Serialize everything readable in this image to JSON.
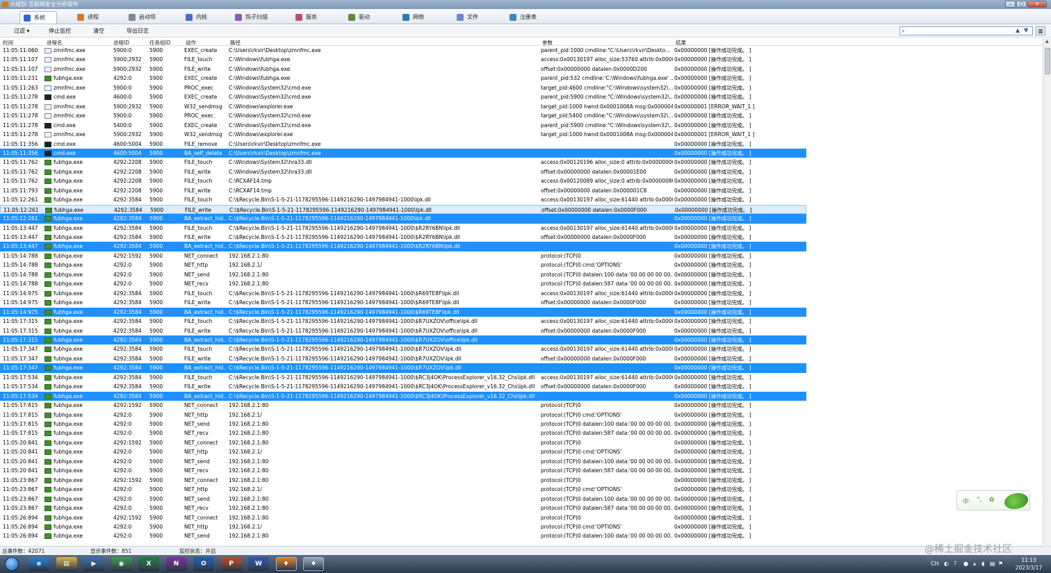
{
  "window": {
    "title": "火绒剑-互联网安全分析软件",
    "min": "–",
    "max": "□",
    "close": "✕"
  },
  "tabs": [
    {
      "label": "系统",
      "icon": "system-icon",
      "color": "#2a6bc9",
      "active": true
    },
    {
      "label": "进程",
      "icon": "process-icon",
      "color": "#d9781e"
    },
    {
      "label": "启动项",
      "icon": "startup-icon",
      "color": "#7a8aa0"
    },
    {
      "label": "内核",
      "icon": "kernel-icon",
      "color": "#4a6fbf"
    },
    {
      "label": "钩子扫描",
      "icon": "hook-scan-icon",
      "color": "#8a5ab8"
    },
    {
      "label": "服务",
      "icon": "service-icon",
      "color": "#c44a6a"
    },
    {
      "label": "驱动",
      "icon": "driver-icon",
      "color": "#5a8a3a"
    },
    {
      "label": "网络",
      "icon": "network-icon",
      "color": "#2a7ab0"
    },
    {
      "label": "文件",
      "icon": "file-icon",
      "color": "#6a8ac8"
    },
    {
      "label": "注册表",
      "icon": "registry-icon",
      "color": "#3a8ab8"
    }
  ],
  "toolbar": {
    "filter": "过滤 ▾",
    "stop": "停止监控",
    "clear": "清空",
    "export": "导出日志"
  },
  "search": {
    "placeholder": "",
    "up": "▲",
    "down": "▼",
    "icon": "⌕"
  },
  "columns": {
    "time": "时间",
    "pname": "进程名",
    "pid": "进程ID",
    "tid": "任务组ID",
    "action": "动作",
    "path": "路径",
    "params": "参数",
    "result": "结果"
  },
  "events": [
    {
      "t": "11:05:11:060",
      "n": "zmnfmc.exe",
      "ic": "app",
      "p": "5900:0",
      "g": "5900",
      "a": "EXEC_create",
      "path": "C:\\Users\\rkvir\\Desktop\\zmnfmc.exe",
      "par": "parent_pid:1000 cmdline:\"C:\\Users\\rkvir\\Deskto...",
      "r": "0x00000000 [操作成功完成。 ]"
    },
    {
      "t": "11:05:11:107",
      "n": "zmnfmc.exe",
      "ic": "app",
      "p": "5900:2932",
      "g": "5900",
      "a": "FILE_touch",
      "path": "C:\\Windows\\fubhga.exe",
      "par": "access:0x00130197 alloc_size:53760 attrib:0x0000...",
      "r": "0x00000000 [操作成功完成。 ]"
    },
    {
      "t": "11:05:11:107",
      "n": "zmnfmc.exe",
      "ic": "app",
      "p": "5900:2932",
      "g": "5900",
      "a": "FILE_write",
      "path": "C:\\Windows\\fubhga.exe",
      "par": "offset:0x00000000 datalen:0x0000D200",
      "r": "0x00000000 [操作成功完成。 ]"
    },
    {
      "t": "11:05:11:231",
      "n": "fubhga.exe",
      "ic": "fub",
      "p": "4292:0",
      "g": "5900",
      "a": "EXEC_create",
      "path": "C:\\Windows\\fubhga.exe",
      "par": "parent_pid:532 cmdline:'C:\\Windows\\fubhga.exe' ...",
      "r": "0x00000000 [操作成功完成。 ]"
    },
    {
      "t": "11:05:11:263",
      "n": "zmnfmc.exe",
      "ic": "app",
      "p": "5900:0",
      "g": "5900",
      "a": "PROC_exec",
      "path": "C:\\Windows\\System32\\cmd.exe",
      "par": "target_pid:4600 cmdline:\"C:\\Windows\\system32\\...",
      "r": "0x00000000 [操作成功完成。 ]"
    },
    {
      "t": "11:05:11:278",
      "n": "cmd.exe",
      "ic": "cmd",
      "p": "4600:0",
      "g": "5900",
      "a": "EXEC_create",
      "path": "C:\\Windows\\System32\\cmd.exe",
      "par": "parent_pid:5900 cmdline:\"C:\\Windows\\system32\\...",
      "r": "0x00000000 [操作成功完成。 ]"
    },
    {
      "t": "11:05:11:278",
      "n": "zmnfmc.exe",
      "ic": "app",
      "p": "5900:2932",
      "g": "5900",
      "a": "W32_sendmsg",
      "path": "C:\\Windows\\explorer.exe",
      "par": "target_pid:1000 hwnd:0x0001008A msg:0x000004...",
      "r": "0x00000001 [ERROR_WAIT_1 ]"
    },
    {
      "t": "11:05:11:278",
      "n": "zmnfmc.exe",
      "ic": "app",
      "p": "5900:0",
      "g": "5900",
      "a": "PROC_exec",
      "path": "C:\\Windows\\System32\\cmd.exe",
      "par": "target_pid:5400 cmdline:\"C:\\Windows\\system32\\...",
      "r": "0x00000000 [操作成功完成。 ]"
    },
    {
      "t": "11:05:11:278",
      "n": "cmd.exe",
      "ic": "cmd",
      "p": "5400:0",
      "g": "5900",
      "a": "EXEC_create",
      "path": "C:\\Windows\\System32\\cmd.exe",
      "par": "parent_pid:5900 cmdline:\"C:\\Windows\\system32\\...",
      "r": "0x00000000 [操作成功完成。 ]"
    },
    {
      "t": "11:05:11:278",
      "n": "zmnfmc.exe",
      "ic": "app",
      "p": "5900:2932",
      "g": "5900",
      "a": "W32_sendmsg",
      "path": "C:\\Windows\\explorer.exe",
      "par": "target_pid:1000 hwnd:0x0001008A msg:0x000004...",
      "r": "0x00000001 [ERROR_WAIT_1 ]"
    },
    {
      "t": "11:05:11:356",
      "n": "cmd.exe",
      "ic": "cmd",
      "p": "4600:5004",
      "g": "5900",
      "a": "FILE_remove",
      "path": "C:\\Users\\rkvir\\Desktop\\zmnfmc.exe",
      "par": "",
      "r": "0x00000000 [操作成功完成。 ]"
    },
    {
      "t": "11:05:11:356",
      "n": "cmd.exe",
      "ic": "cmd",
      "p": "4600:5004",
      "g": "5900",
      "a": "BA_self_delete",
      "path": "C:\\Users\\rkvir\\Desktop\\zmnfmc.exe",
      "par": "",
      "r": "0x00000000 [操作成功完成。 ]",
      "sel": true
    },
    {
      "t": "11:05:11:762",
      "n": "fubhga.exe",
      "ic": "fub",
      "p": "4292:2208",
      "g": "5900",
      "a": "FILE_touch",
      "path": "C:\\Windows\\System32\\hra33.dll",
      "par": "access:0x00120196 alloc_size:0 attrib:0x00000000...",
      "r": "0x00000000 [操作成功完成。 ]"
    },
    {
      "t": "11:05:11:762",
      "n": "fubhga.exe",
      "ic": "fub",
      "p": "4292:2208",
      "g": "5900",
      "a": "FILE_write",
      "path": "C:\\Windows\\System32\\hra33.dll",
      "par": "offset:0x00000000 datalen:0x00001E00",
      "r": "0x00000000 [操作成功完成。 ]"
    },
    {
      "t": "11:05:11:762",
      "n": "fubhga.exe",
      "ic": "fub",
      "p": "4292:2208",
      "g": "5900",
      "a": "FILE_touch",
      "path": "C:\\RCXAF14.tmp",
      "par": "access:0x00120089 alloc_size:0 attrib:0x00000080...",
      "r": "0x00000000 [操作成功完成。 ]"
    },
    {
      "t": "11:05:11:793",
      "n": "fubhga.exe",
      "ic": "fub",
      "p": "4292:2208",
      "g": "5900",
      "a": "FILE_write",
      "path": "C:\\RCXAF14.tmp",
      "par": "offset:0x00000000 datalen:0x000001C8",
      "r": "0x00000000 [操作成功完成。 ]"
    },
    {
      "t": "11:05:12:261",
      "n": "fubhga.exe",
      "ic": "fub",
      "p": "4292:3584",
      "g": "5900",
      "a": "FILE_touch",
      "path": "C:\\$Recycle.Bin\\S-1-5-21-1178295596-1149216290-1497984941-1000\\lpk.dll",
      "par": "access:0x00130197 alloc_size:61440 attrib:0x0000...",
      "r": "0x00000000 [操作成功完成。 ]"
    },
    {
      "t": "11:05:12:261",
      "n": "fubhga.exe",
      "ic": "fub",
      "p": "4292:3584",
      "g": "5900",
      "a": "FILE_write",
      "path": "C:\\$Recycle.Bin\\S-1-5-21-1178295596-1149216290-1497984941-1000\\lpk.dll",
      "par": "offset:0x00000000 datalen:0x0000F000",
      "r": "0x00000000 [操作成功完成。 ]",
      "hov": true
    },
    {
      "t": "11:05:12:261",
      "n": "fubhga.exe",
      "ic": "fub",
      "p": "4292:3584",
      "g": "5900",
      "a": "BA_extract_hid...",
      "path": "C:\\$Recycle.Bin\\S-1-5-21-1178295596-1149216290-1497984941-1000\\lpk.dll",
      "par": "",
      "r": "0x00000000 [操作成功完成。 ]",
      "sel": true
    },
    {
      "t": "11:05:13:447",
      "n": "fubhga.exe",
      "ic": "fub",
      "p": "4292:3584",
      "g": "5900",
      "a": "FILE_touch",
      "path": "C:\\$Recycle.Bin\\S-1-5-21-1178295596-1149216290-1497984941-1000\\$R2RY6BN\\lpk.dll",
      "par": "access:0x00130197 alloc_size:61440 attrib:0x0000...",
      "r": "0x00000000 [操作成功完成。 ]"
    },
    {
      "t": "11:05:13:447",
      "n": "fubhga.exe",
      "ic": "fub",
      "p": "4292:3584",
      "g": "5900",
      "a": "FILE_write",
      "path": "C:\\$Recycle.Bin\\S-1-5-21-1178295596-1149216290-1497984941-1000\\$R2RY6BN\\lpk.dll",
      "par": "offset:0x00000000 datalen:0x0000F000",
      "r": "0x00000000 [操作成功完成。 ]"
    },
    {
      "t": "11:05:13:447",
      "n": "fubhga.exe",
      "ic": "fub",
      "p": "4292:3584",
      "g": "5900",
      "a": "BA_extract_hid...",
      "path": "C:\\$Recycle.Bin\\S-1-5-21-1178295596-1149216290-1497984941-1000\\$R2RY6BN\\lpk.dll",
      "par": "",
      "r": "0x00000000 [操作成功完成。 ]",
      "sel": true
    },
    {
      "t": "11:05:14:788",
      "n": "fubhga.exe",
      "ic": "fub",
      "p": "4292:1592",
      "g": "5900",
      "a": "NET_connect",
      "path": "192.168.2.1:80",
      "par": "protocol:(TCP)0",
      "r": "0x00000000 [操作成功完成。 ]"
    },
    {
      "t": "11:05:14:788",
      "n": "fubhga.exe",
      "ic": "fub",
      "p": "4292:0",
      "g": "5900",
      "a": "NET_http",
      "path": "192.168.2.1/",
      "par": "protocol:(TCP)0 cmd:'OPTIONS'",
      "r": "0x00000000 [操作成功完成。 ]"
    },
    {
      "t": "11:05:14:788",
      "n": "fubhga.exe",
      "ic": "fub",
      "p": "4292:0",
      "g": "5900",
      "a": "NET_send",
      "path": "192.168.2.1:80",
      "par": "protocol:(TCP)0 datalen:100 data:'00 00 00 00 00...",
      "r": "0x00000000 [操作成功完成。 ]"
    },
    {
      "t": "11:05:14:788",
      "n": "fubhga.exe",
      "ic": "fub",
      "p": "4292:0",
      "g": "5900",
      "a": "NET_recv",
      "path": "192.168.2.1:80",
      "par": "protocol:(TCP)0 datalen:587 data:'00 00 00 00 00...",
      "r": "0x00000000 [操作成功完成。 ]"
    },
    {
      "t": "11:05:14:975",
      "n": "fubhga.exe",
      "ic": "fub",
      "p": "4292:3584",
      "g": "5900",
      "a": "FILE_touch",
      "path": "C:\\$Recycle.Bin\\S-1-5-21-1178295596-1149216290-1497984941-1000\\$R69TE8F\\lpk.dll",
      "par": "access:0x00130197 alloc_size:61440 attrib:0x0000...",
      "r": "0x00000000 [操作成功完成。 ]"
    },
    {
      "t": "11:05:14:975",
      "n": "fubhga.exe",
      "ic": "fub",
      "p": "4292:3584",
      "g": "5900",
      "a": "FILE_write",
      "path": "C:\\$Recycle.Bin\\S-1-5-21-1178295596-1149216290-1497984941-1000\\$R69TE8F\\lpk.dll",
      "par": "offset:0x00000000 datalen:0x0000F000",
      "r": "0x00000000 [操作成功完成。 ]"
    },
    {
      "t": "11:05:14:975",
      "n": "fubhga.exe",
      "ic": "fub",
      "p": "4292:3584",
      "g": "5900",
      "a": "BA_extract_hid...",
      "path": "C:\\$Recycle.Bin\\S-1-5-21-1178295596-1149216290-1497984941-1000\\$R69TE8F\\lpk.dll",
      "par": "",
      "r": "0x00000000 [操作成功完成。 ]",
      "sel": true
    },
    {
      "t": "11:05:17:315",
      "n": "fubhga.exe",
      "ic": "fub",
      "p": "4292:3584",
      "g": "5900",
      "a": "FILE_touch",
      "path": "C:\\$Recycle.Bin\\S-1-5-21-1178295596-1149216290-1497984941-1000\\$R7UXZOV\\office\\lpk.dll",
      "par": "access:0x00130197 alloc_size:61440 attrib:0x0000...",
      "r": "0x00000000 [操作成功完成。 ]"
    },
    {
      "t": "11:05:17:315",
      "n": "fubhga.exe",
      "ic": "fub",
      "p": "4292:3584",
      "g": "5900",
      "a": "FILE_write",
      "path": "C:\\$Recycle.Bin\\S-1-5-21-1178295596-1149216290-1497984941-1000\\$R7UXZOV\\office\\lpk.dll",
      "par": "offset:0x00000000 datalen:0x0000F000",
      "r": "0x00000000 [操作成功完成。 ]"
    },
    {
      "t": "11:05:17:315",
      "n": "fubhga.exe",
      "ic": "fub",
      "p": "4292:3584",
      "g": "5900",
      "a": "BA_extract_hid...",
      "path": "C:\\$Recycle.Bin\\S-1-5-21-1178295596-1149216290-1497984941-1000\\$R7UXZOV\\office\\lpk.dll",
      "par": "",
      "r": "0x00000000 [操作成功完成。 ]",
      "sel": true
    },
    {
      "t": "11:05:17:347",
      "n": "fubhga.exe",
      "ic": "fub",
      "p": "4292:3584",
      "g": "5900",
      "a": "FILE_touch",
      "path": "C:\\$Recycle.Bin\\S-1-5-21-1178295596-1149216290-1497984941-1000\\$R7UXZOV\\lpk.dll",
      "par": "access:0x00130197 alloc_size:61440 attrib:0x0000...",
      "r": "0x00000000 [操作成功完成。 ]"
    },
    {
      "t": "11:05:17:347",
      "n": "fubhga.exe",
      "ic": "fub",
      "p": "4292:3584",
      "g": "5900",
      "a": "FILE_write",
      "path": "C:\\$Recycle.Bin\\S-1-5-21-1178295596-1149216290-1497984941-1000\\$R7UXZOV\\lpk.dll",
      "par": "offset:0x00000000 datalen:0x0000F000",
      "r": "0x00000000 [操作成功完成。 ]"
    },
    {
      "t": "11:05:17:347",
      "n": "fubhga.exe",
      "ic": "fub",
      "p": "4292:3584",
      "g": "5900",
      "a": "BA_extract_hid...",
      "path": "C:\\$Recycle.Bin\\S-1-5-21-1178295596-1149216290-1497984941-1000\\$R7UXZOV\\lpk.dll",
      "par": "",
      "r": "0x00000000 [操作成功完成。 ]",
      "sel": true
    },
    {
      "t": "11:05:17:534",
      "n": "fubhga.exe",
      "ic": "fub",
      "p": "4292:3584",
      "g": "5900",
      "a": "FILE_touch",
      "path": "C:\\$Recycle.Bin\\S-1-5-21-1178295596-1149216290-1497984941-1000\\$RC3J4OK\\ProcessExplorer_v16.32_Chs\\lpk.dll",
      "par": "access:0x00130197 alloc_size:61440 attrib:0x0000...",
      "r": "0x00000000 [操作成功完成。 ]"
    },
    {
      "t": "11:05:17:534",
      "n": "fubhga.exe",
      "ic": "fub",
      "p": "4292:3584",
      "g": "5900",
      "a": "FILE_write",
      "path": "C:\\$Recycle.Bin\\S-1-5-21-1178295596-1149216290-1497984941-1000\\$RC3J4OK\\ProcessExplorer_v16.32_Chs\\lpk.dll",
      "par": "offset:0x00000000 datalen:0x0000F000",
      "r": "0x00000000 [操作成功完成。 ]"
    },
    {
      "t": "11:05:17:534",
      "n": "fubhga.exe",
      "ic": "fub",
      "p": "4292:3584",
      "g": "5900",
      "a": "BA_extract_hid...",
      "path": "C:\\$Recycle.Bin\\S-1-5-21-1178295596-1149216290-1497984941-1000\\$RC3J4OK\\ProcessExplorer_v16.32_Chs\\lpk.dll",
      "par": "",
      "r": "0x00000000 [操作成功完成。 ]",
      "sel": true
    },
    {
      "t": "11:05:17:815",
      "n": "fubhga.exe",
      "ic": "fub",
      "p": "4292:1592",
      "g": "5900",
      "a": "NET_connect",
      "path": "192.168.2.1:80",
      "par": "protocol:(TCP)0",
      "r": "0x00000000 [操作成功完成。 ]"
    },
    {
      "t": "11:05:17:815",
      "n": "fubhga.exe",
      "ic": "fub",
      "p": "4292:0",
      "g": "5900",
      "a": "NET_http",
      "path": "192.168.2.1/",
      "par": "protocol:(TCP)0 cmd:'OPTIONS'",
      "r": "0x00000000 [操作成功完成。 ]"
    },
    {
      "t": "11:05:17:815",
      "n": "fubhga.exe",
      "ic": "fub",
      "p": "4292:0",
      "g": "5900",
      "a": "NET_send",
      "path": "192.168.2.1:80",
      "par": "protocol:(TCP)0 datalen:100 data:'00 00 00 00 00...",
      "r": "0x00000000 [操作成功完成。 ]"
    },
    {
      "t": "11:05:17:815",
      "n": "fubhga.exe",
      "ic": "fub",
      "p": "4292:0",
      "g": "5900",
      "a": "NET_recv",
      "path": "192.168.2.1:80",
      "par": "protocol:(TCP)0 datalen:587 data:'00 00 00 00 00...",
      "r": "0x00000000 [操作成功完成。 ]"
    },
    {
      "t": "11:05:20:841",
      "n": "fubhga.exe",
      "ic": "fub",
      "p": "4292:1592",
      "g": "5900",
      "a": "NET_connect",
      "path": "192.168.2.1:80",
      "par": "protocol:(TCP)0",
      "r": "0x00000000 [操作成功完成。 ]"
    },
    {
      "t": "11:05:20:841",
      "n": "fubhga.exe",
      "ic": "fub",
      "p": "4292:0",
      "g": "5900",
      "a": "NET_http",
      "path": "192.168.2.1/",
      "par": "protocol:(TCP)0 cmd:'OPTIONS'",
      "r": "0x00000000 [操作成功完成。 ]"
    },
    {
      "t": "11:05:20:841",
      "n": "fubhga.exe",
      "ic": "fub",
      "p": "4292:0",
      "g": "5900",
      "a": "NET_send",
      "path": "192.168.2.1:80",
      "par": "protocol:(TCP)0 datalen:100 data:'00 00 00 00 00...",
      "r": "0x00000000 [操作成功完成。 ]"
    },
    {
      "t": "11:05:20:841",
      "n": "fubhga.exe",
      "ic": "fub",
      "p": "4292:0",
      "g": "5900",
      "a": "NET_recv",
      "path": "192.168.2.1:80",
      "par": "protocol:(TCP)0 datalen:587 data:'00 00 00 00 00...",
      "r": "0x00000000 [操作成功完成。 ]"
    },
    {
      "t": "11:05:23:867",
      "n": "fubhga.exe",
      "ic": "fub",
      "p": "4292:1592",
      "g": "5900",
      "a": "NET_connect",
      "path": "192.168.2.1:80",
      "par": "protocol:(TCP)0",
      "r": "0x00000000 [操作成功完成。 ]"
    },
    {
      "t": "11:05:23:867",
      "n": "fubhga.exe",
      "ic": "fub",
      "p": "4292:0",
      "g": "5900",
      "a": "NET_http",
      "path": "192.168.2.1/",
      "par": "protocol:(TCP)0 cmd:'OPTIONS'",
      "r": "0x00000000 [操作成功完成。 ]"
    },
    {
      "t": "11:05:23:867",
      "n": "fubhga.exe",
      "ic": "fub",
      "p": "4292:0",
      "g": "5900",
      "a": "NET_send",
      "path": "192.168.2.1:80",
      "par": "protocol:(TCP)0 datalen:100 data:'00 00 00 00 00...",
      "r": "0x00000000 [操作成功完成。 ]"
    },
    {
      "t": "11:05:23:867",
      "n": "fubhga.exe",
      "ic": "fub",
      "p": "4292:0",
      "g": "5900",
      "a": "NET_recv",
      "path": "192.168.2.1:80",
      "par": "protocol:(TCP)0 datalen:587 data:'00 00 00 00 00...",
      "r": "0x00000000 [操作成功完成。 ]"
    },
    {
      "t": "11:05:26:894",
      "n": "fubhga.exe",
      "ic": "fub",
      "p": "4292:1592",
      "g": "5900",
      "a": "NET_connect",
      "path": "192.168.2.1:80",
      "par": "protocol:(TCP)0",
      "r": "0x00000000 [操作成功完成。 ]"
    },
    {
      "t": "11:05:26:894",
      "n": "fubhga.exe",
      "ic": "fub",
      "p": "4292:0",
      "g": "5900",
      "a": "NET_http",
      "path": "192.168.2.1/",
      "par": "protocol:(TCP)0 cmd:'OPTIONS'",
      "r": "0x00000000 [操作成功完成。 ]"
    },
    {
      "t": "11:05:26:894",
      "n": "fubhga.exe",
      "ic": "fub",
      "p": "4292:0",
      "g": "5900",
      "a": "NET_send",
      "path": "192.168.2.1:80",
      "par": "protocol:(TCP)0 datalen:100 data:'00 00 00 00 00...",
      "r": "0x00000000 [操作成功完成。 ]"
    }
  ],
  "status": {
    "total": "总事件数：42071",
    "shown": "显示事件数：851",
    "monitor": "监控状态：开启"
  },
  "ime": {
    "a": "中",
    "b": "°,",
    "c": "✿"
  },
  "watermark": "@稀土掘金技术社区",
  "taskbar": {
    "apps": [
      {
        "name": "ie-icon",
        "label": "e",
        "color": "#1f7fd6"
      },
      {
        "name": "explorer-icon",
        "label": "▤",
        "color": "#d8b247"
      },
      {
        "name": "media-player-icon",
        "label": "▶",
        "color": "#3a6fb0"
      },
      {
        "name": "chrome-icon",
        "label": "◉",
        "color": "#3a9a4a"
      },
      {
        "name": "excel-icon",
        "label": "X",
        "color": "#1f7a3e"
      },
      {
        "name": "onenote-icon",
        "label": "N",
        "color": "#7b2e9c"
      },
      {
        "name": "outlook-icon",
        "label": "O",
        "color": "#1a5fb4"
      },
      {
        "name": "powerpoint-icon",
        "label": "P",
        "color": "#c4461e"
      },
      {
        "name": "word-icon",
        "label": "W",
        "color": "#2a57a8"
      },
      {
        "name": "huorong-icon",
        "label": "♦",
        "color": "#e07a1e"
      },
      {
        "name": "huorong-sword-icon",
        "label": "♦",
        "color": "#9aa7b8"
      }
    ],
    "tray": {
      "lang": "CH",
      "time": "11:13",
      "date": "2023/3/17"
    }
  }
}
